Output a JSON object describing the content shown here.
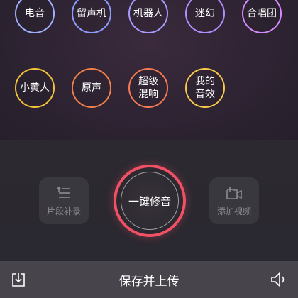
{
  "effects": [
    {
      "label": "电音",
      "color": "#9fb0ff"
    },
    {
      "label": "留声机",
      "color": "#8e9cff"
    },
    {
      "label": "机器人",
      "color": "#a79bff"
    },
    {
      "label": "迷幻",
      "color": "#b38dff"
    },
    {
      "label": "合唱团",
      "color": "#d58bff"
    },
    {
      "label": "小黄人",
      "color": "#f4c23a"
    },
    {
      "label": "原声",
      "color": "#f3804a"
    },
    {
      "label": "超级\n混响",
      "color": "#f67a52"
    },
    {
      "label": "我的\n音效",
      "color": "#f7c84a"
    }
  ],
  "controls": {
    "segment_label": "片段补录",
    "main_label": "一键修音",
    "video_label": "添加视频"
  },
  "bottom_bar": {
    "title": "保存并上传"
  },
  "icons": {
    "segment": "segment-record-icon",
    "video": "add-video-icon",
    "download": "download-icon",
    "volume": "volume-icon"
  },
  "colors": {
    "accent": "#f25065"
  }
}
